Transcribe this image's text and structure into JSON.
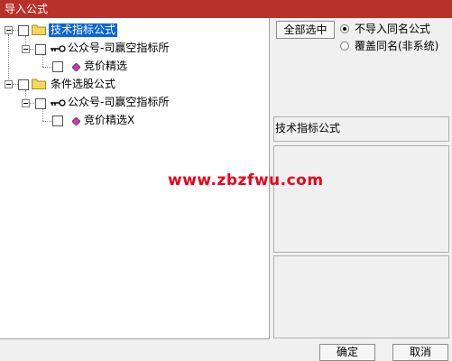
{
  "window": {
    "title": "导入公式"
  },
  "tree": {
    "nodes": [
      {
        "label": "技术指标公式"
      },
      {
        "label": "公众号-司赢空指标所"
      },
      {
        "label": "竞价精选"
      },
      {
        "label": "条件选股公式"
      },
      {
        "label": "公众号-司赢空指标所"
      },
      {
        "label": "竞价精选X"
      }
    ]
  },
  "options": {
    "select_all_label": "全部选中",
    "radio_skip_label": "不导入同名公式",
    "radio_overwrite_label": "覆盖同名(非系统)",
    "selected": "skip"
  },
  "details": {
    "formula_type": "技术指标公式"
  },
  "footer": {
    "ok_label": "确定",
    "cancel_label": "取消"
  },
  "watermark": "www.zbzfwu.com",
  "colors": {
    "titlebar": "#b8312a",
    "selection": "#0a64d8",
    "watermark": "#e8001c"
  }
}
